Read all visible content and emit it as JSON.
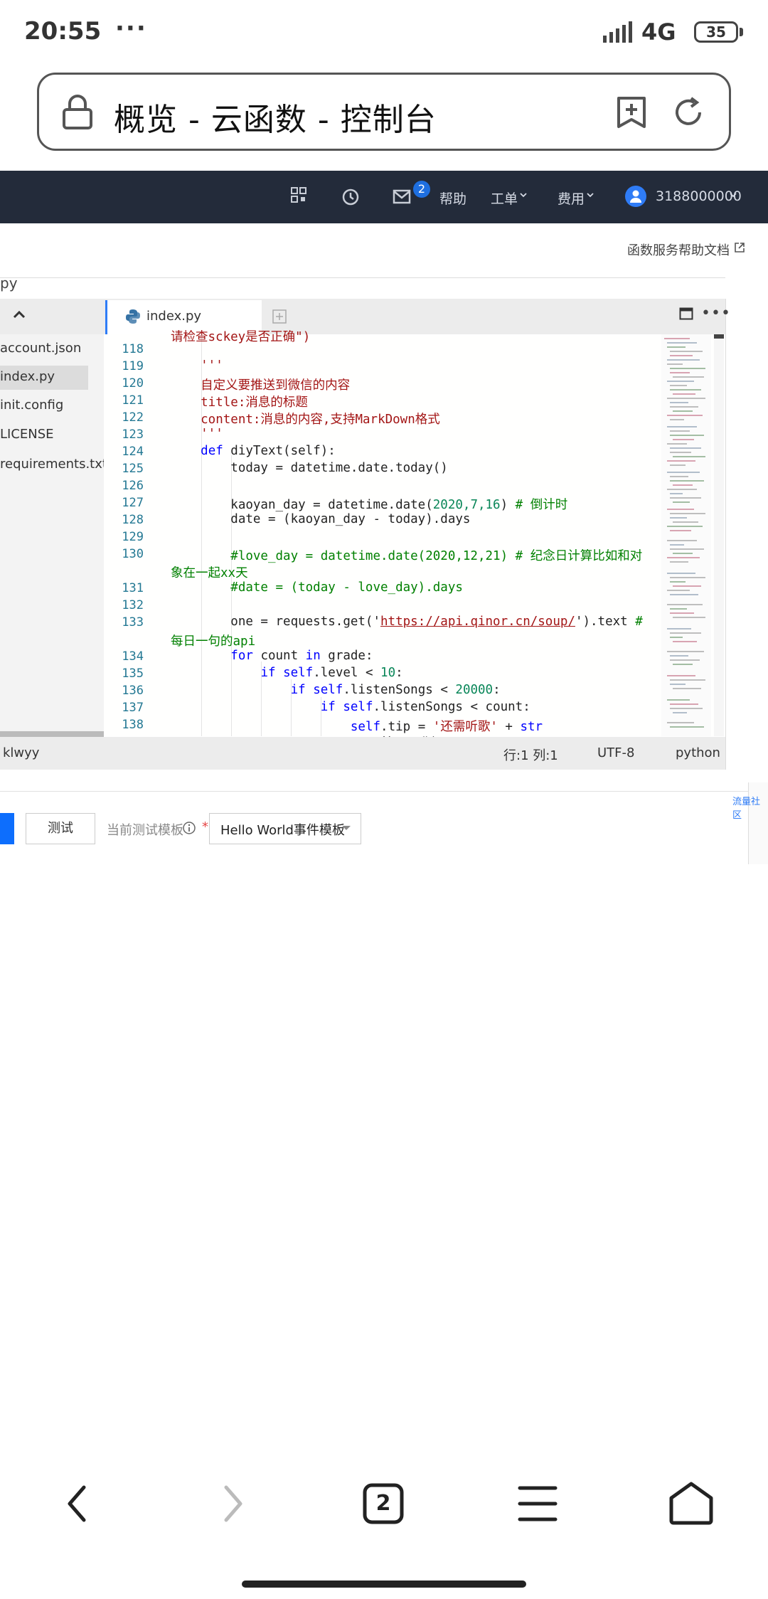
{
  "status_bar": {
    "time": "20:55",
    "dots": "···",
    "network": "4G",
    "battery": "35"
  },
  "address_bar": {
    "title": "概览 - 云函数 - 控制台"
  },
  "top_nav": {
    "mail_badge": "2",
    "help": "帮助",
    "ticket": "工单",
    "billing": "费用",
    "account": "3188000000"
  },
  "help_doc": "函数服务帮助文档",
  "breadcrumb_fragment": "py",
  "files": [
    "account.json",
    "index.py",
    "init.config",
    "LICENSE",
    "requirements.txt"
  ],
  "tab": {
    "label": "index.py"
  },
  "code": {
    "top_partial": "请检查sckey是否正确\")",
    "line_118": "",
    "line_119": "    '''",
    "line_120": "    自定义要推送到微信的内容",
    "line_121": "    title:消息的标题",
    "line_122": "    content:消息的内容,支持MarkDown格式",
    "line_123": "    '''",
    "line_124_kw": "def",
    "line_124_rest": " diyText(self):",
    "line_125": "        today = datetime.date.today()",
    "line_127_a": "        kaoyan_day = datetime.date(",
    "line_127_n": "2020,7,16",
    "line_127_b": ") ",
    "line_127_c": "# 倒计时",
    "line_128": "        date = (kaoyan_day - today).days",
    "line_130": "        #love_day = datetime.date(2020,12,21) # 纪念日计算比如和对",
    "line_130_wrap": "象在一起xx天",
    "line_131": "        #date = (today - love_day).days",
    "line_133_a": "        one = requests.get('",
    "line_133_url": "https://api.qinor.cn/soup/",
    "line_133_b": "').text ",
    "line_133_c": "#",
    "line_133_wrap": "每日一句的api",
    "line_134_kw1": "for",
    "line_134_mid": " count ",
    "line_134_kw2": "in",
    "line_134_rest": " grade:",
    "line_135_kw": "if",
    "line_135_self": "self",
    "line_135_rest": ".level < ",
    "line_135_num": "10",
    "line_135_end": ":",
    "line_136_kw": "if",
    "line_136_self": "self",
    "line_136_rest": ".listenSongs < ",
    "line_136_num": "20000",
    "line_136_end": ":",
    "line_137_kw": "if",
    "line_137_self": "self",
    "line_137_rest": ".listenSongs < count:",
    "line_138_self": "self",
    "line_138_rest": ".tip = ",
    "line_138_str": "'还需听歌'",
    "line_138_plus": " + ",
    "line_138_kw": "str",
    "line_138_wrap": "(count-self.listenSongs) + '首即可升级'"
  },
  "line_numbers": [
    "118",
    "119",
    "120",
    "121",
    "122",
    "123",
    "124",
    "125",
    "126",
    "127",
    "128",
    "129",
    "130",
    "131",
    "132",
    "133",
    "134",
    "135",
    "136",
    "137",
    "138"
  ],
  "status_line": {
    "left": "klwyy",
    "position": "行:1 列:1",
    "encoding": "UTF-8",
    "language": "python"
  },
  "side_link": "流量社区",
  "controls": {
    "test_button": "测试",
    "template_label": "当前测试模板",
    "required": "*",
    "template_value": "Hello World事件模板"
  },
  "bottom_nav": {
    "tabs_count": "2"
  }
}
